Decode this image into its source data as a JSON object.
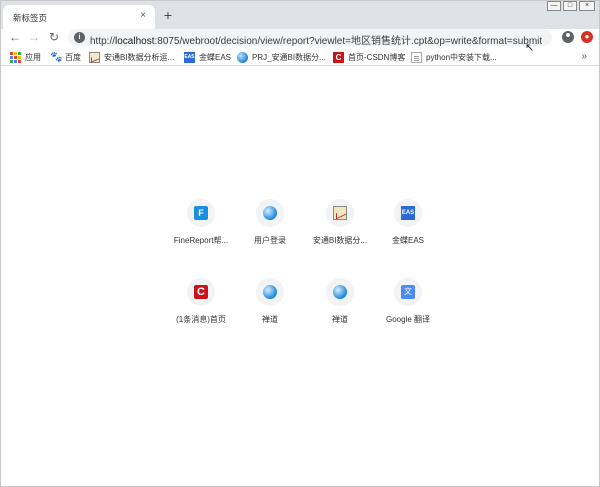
{
  "tab": {
    "title": "新标签页",
    "close_glyph": "×"
  },
  "new_tab_glyph": "+",
  "window_controls": {
    "minimize": "—",
    "maximize": "□",
    "close": "×"
  },
  "toolbar": {
    "back_glyph": "←",
    "forward_glyph": "→",
    "reload_glyph": "↻",
    "info_glyph": "i",
    "url_prefix": "http://",
    "url_host": "localhost",
    "url_rest": ":8075/webroot/decision/view/report?viewlet=地区销售统计.cpt&op=write&format=submit",
    "cursor_glyph": "↖",
    "extension_glyph": "●"
  },
  "bookmarks": {
    "items": [
      {
        "label": "应用",
        "icon": "apps-icon"
      },
      {
        "label": "百度",
        "icon": "baidu-paw-icon"
      },
      {
        "label": "安通BI数据分析运...",
        "icon": "chart-icon"
      },
      {
        "label": "金蝶EAS",
        "icon": "eas-icon"
      },
      {
        "label": "PRJ_安通BI数据分...",
        "icon": "globe-icon"
      },
      {
        "label": "首页-CSDN博客",
        "icon": "csdn-icon"
      },
      {
        "label": "python中安装下载...",
        "icon": "document-icon"
      }
    ],
    "more_glyph": "»"
  },
  "tiles": [
    {
      "label": "FineReport帮...",
      "icon": "finereport-icon",
      "glyph": "F"
    },
    {
      "label": "用户登录",
      "icon": "globe-icon",
      "glyph": ""
    },
    {
      "label": "安通BI数据分...",
      "icon": "chart-icon",
      "glyph": ""
    },
    {
      "label": "金蝶EAS",
      "icon": "eas-icon",
      "glyph": "EAS"
    },
    {
      "label": "(1条消息)首页",
      "icon": "csdn-icon",
      "glyph": "C"
    },
    {
      "label": "禅道",
      "icon": "globe-icon",
      "glyph": ""
    },
    {
      "label": "禅道",
      "icon": "globe-icon",
      "glyph": ""
    },
    {
      "label": "Google 翻译",
      "icon": "google-translate-icon",
      "glyph": "文"
    }
  ],
  "colors": {
    "tabstrip_bg": "#dee1e6",
    "omnibox_bg": "#f1f3f4",
    "csdn_red": "#c9141a",
    "eas_blue": "#2a6bd8",
    "extension_red": "#d93025"
  }
}
